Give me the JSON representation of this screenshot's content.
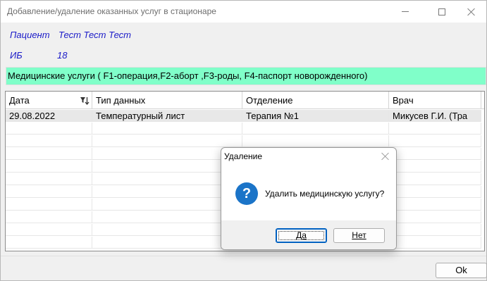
{
  "window": {
    "title": "Добавление/удаление оказанных услуг в стационаре"
  },
  "patient": {
    "label": "Пациент",
    "name": "Тест Тест Тест",
    "ib_label": "ИБ",
    "ib_value": "18"
  },
  "services_bar": {
    "text": "Медицинские услуги ( F1-операция,F2-аборт ,F3-роды, F4-паспорт новорожденного)",
    "color": "#80ffc9"
  },
  "grid": {
    "columns": [
      "Дата",
      "Тип данных",
      "Отделение",
      "Врач"
    ],
    "rows": [
      [
        "29.08.2022",
        "Температурный лист",
        "Терапия №1",
        "Микусев Г.И. (Тра"
      ]
    ]
  },
  "footer": {
    "ok_label": "Ok"
  },
  "dialog": {
    "title": "Удаление",
    "message": "Удалить медицинскую услугу?",
    "icon": "question-icon",
    "yes_label": "Да",
    "no_label": "Нет"
  }
}
